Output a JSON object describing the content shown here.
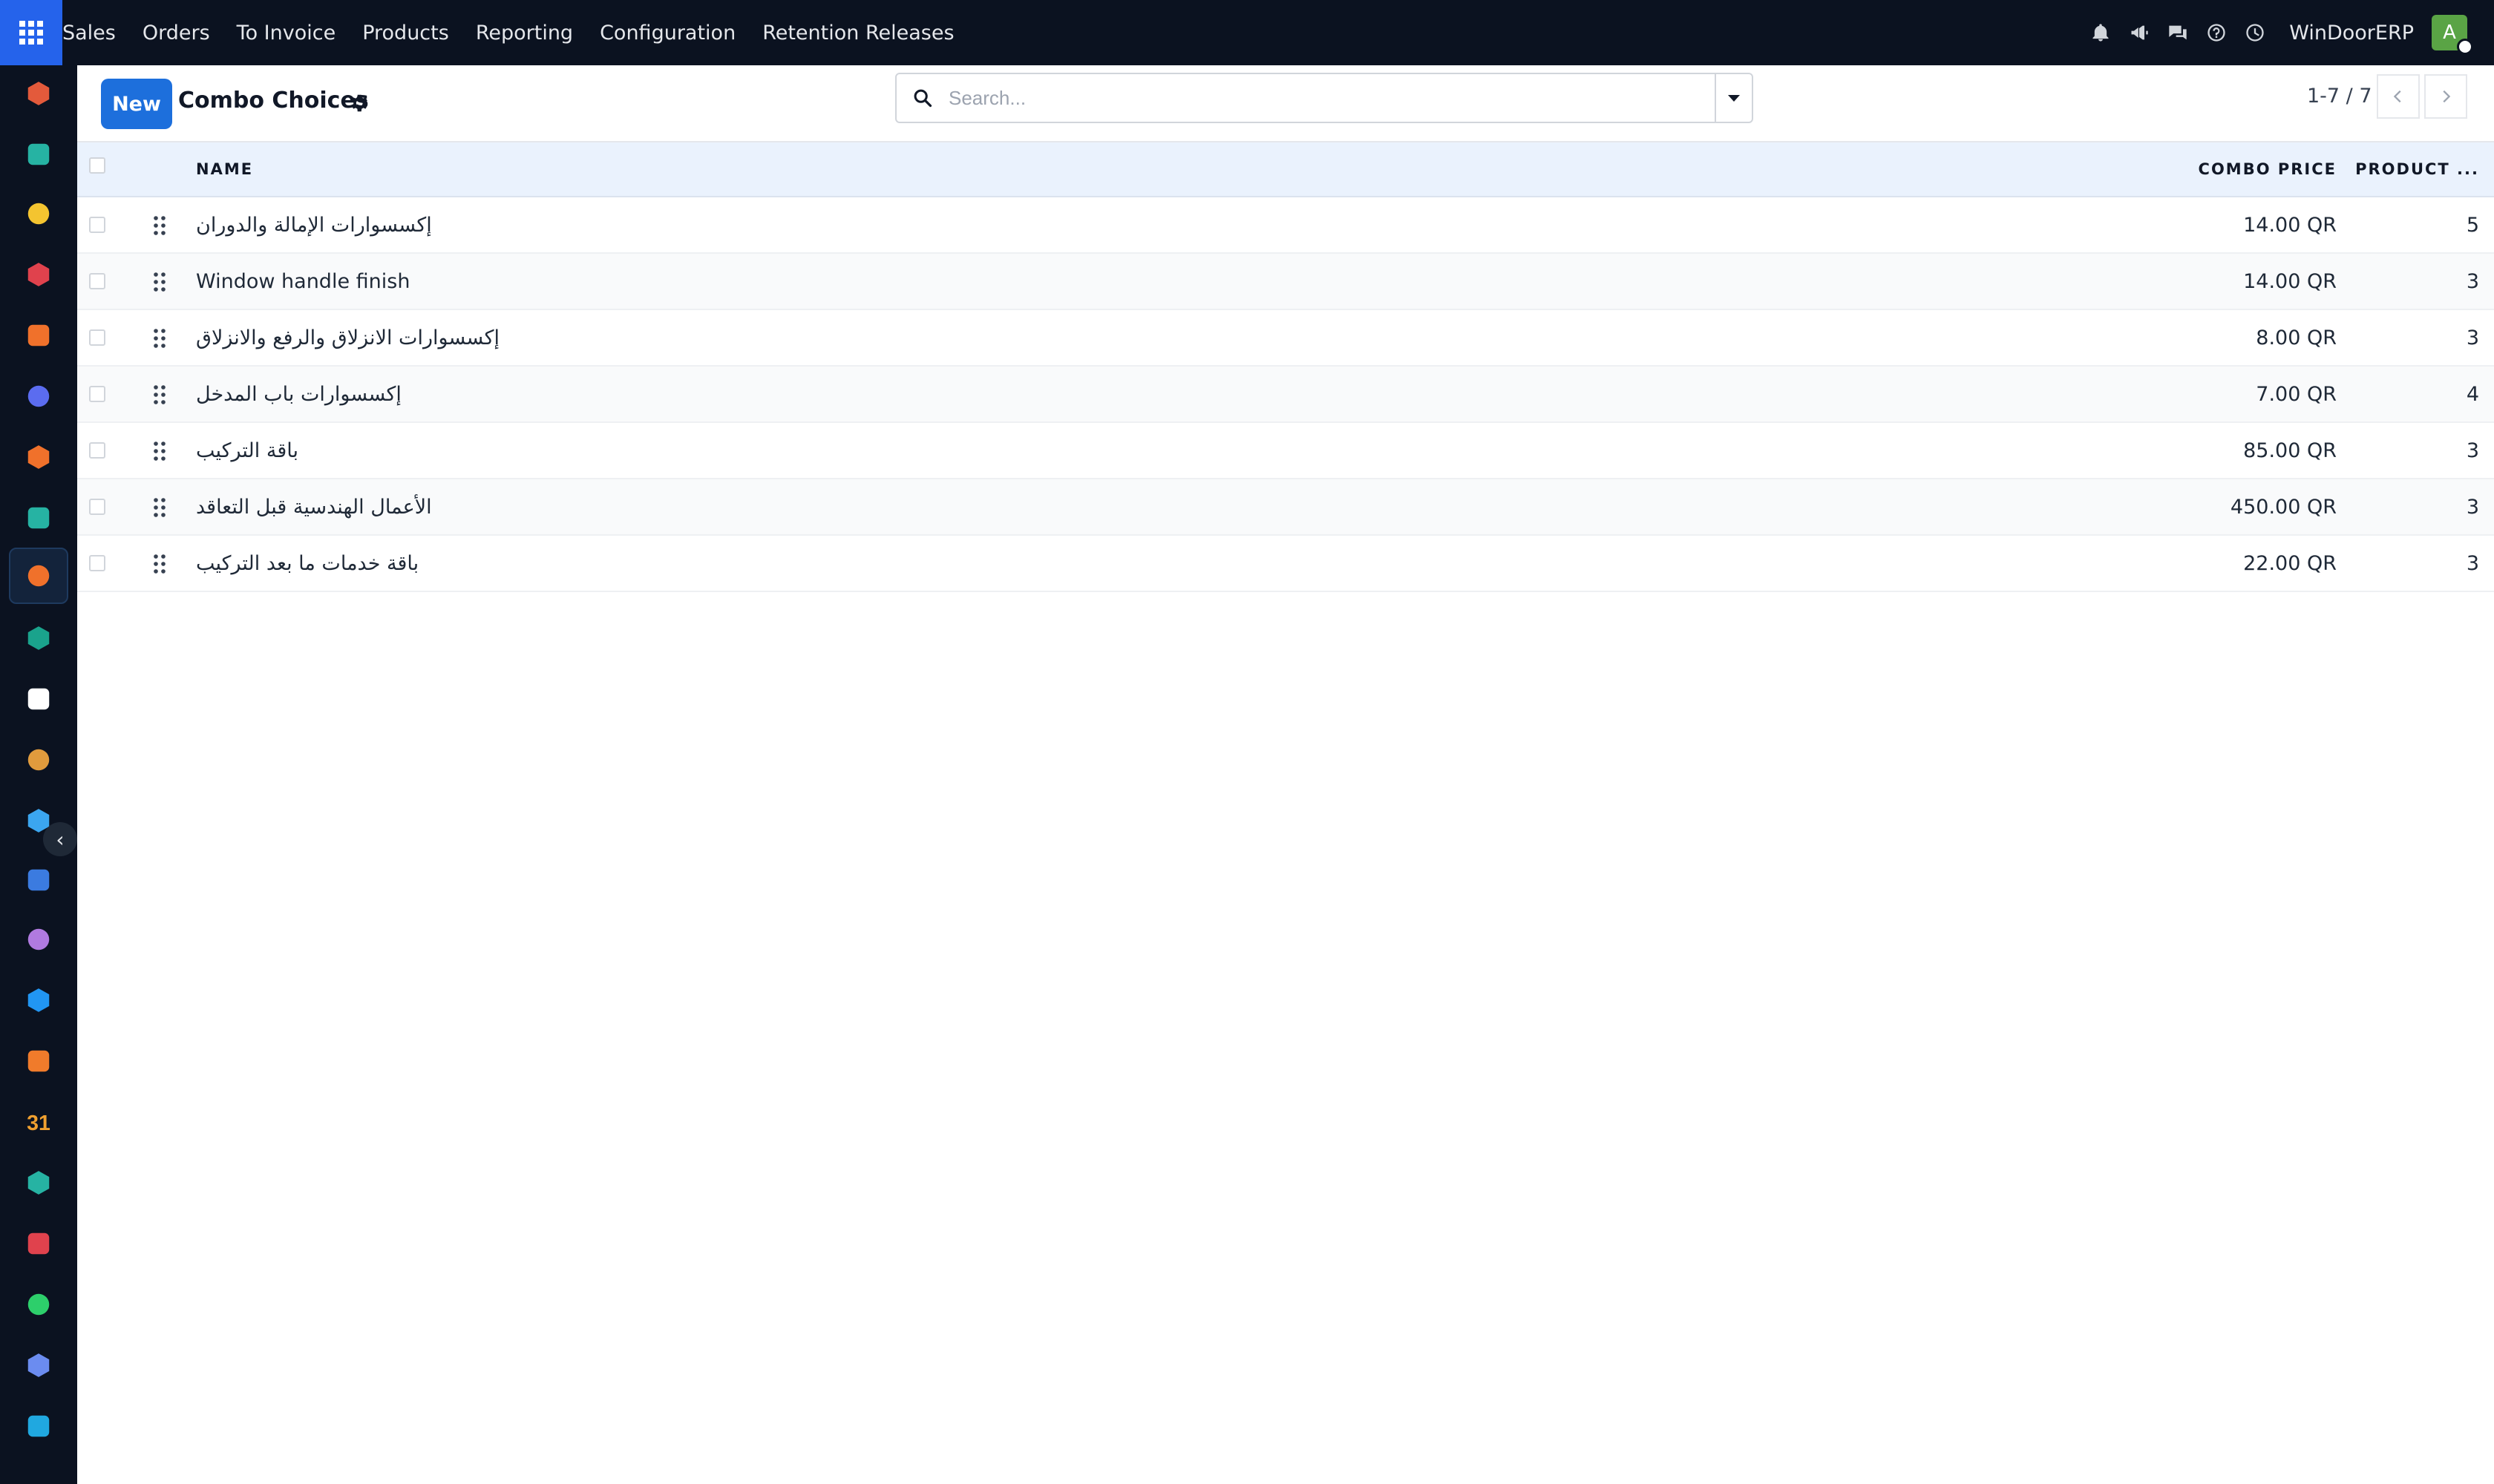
{
  "navbar": {
    "menu": [
      "Sales",
      "Orders",
      "To Invoice",
      "Products",
      "Reporting",
      "Configuration",
      "Retention Releases"
    ],
    "company": "WinDoorERP",
    "avatar_letter": "A"
  },
  "sidebar": {
    "apps": [
      {
        "icon": "cube-icon",
        "color": "#e35a3b"
      },
      {
        "icon": "chevron-check-icon",
        "color": "#26b3a3"
      },
      {
        "icon": "paper-plane-icon",
        "color": "#f4c430"
      },
      {
        "icon": "pie-chart-icon",
        "color": "#e0424d"
      },
      {
        "icon": "hexagon-icon",
        "color": "#f0712b"
      },
      {
        "icon": "mail-m-icon",
        "color": "#5b6cf0"
      },
      {
        "icon": "chat-bubble-icon",
        "color": "#f0712b"
      },
      {
        "icon": "chevron-check-icon",
        "color": "#26b3a3"
      },
      {
        "icon": "sales-chart-icon",
        "color": "#f0712b"
      },
      {
        "icon": "contacts-icon",
        "color": "#1aa38c"
      },
      {
        "icon": "box-icon",
        "color": "#ffffff"
      },
      {
        "icon": "tools-icon",
        "color": "#e09b3d"
      },
      {
        "icon": "checkmark-icon",
        "color": "#3ba6f0"
      },
      {
        "icon": "book-icon",
        "color": "#3b7be0"
      },
      {
        "icon": "package-icon",
        "color": "#b07ae0"
      },
      {
        "icon": "invoice-dollar-icon",
        "color": "#2196f3"
      },
      {
        "icon": "team-icon",
        "color": "#f07b2b"
      },
      {
        "icon": "calendar-31-icon",
        "color": "#f0a030"
      },
      {
        "icon": "pen-icon",
        "color": "#26b3a3"
      },
      {
        "icon": "dashboard-icon",
        "color": "#e0424d"
      },
      {
        "icon": "whatsapp-icon",
        "color": "#2dcf6b"
      },
      {
        "icon": "gauge-icon",
        "color": "#6b8cf0"
      },
      {
        "icon": "wave-icon",
        "color": "#20a8e0"
      }
    ]
  },
  "control": {
    "new_label": "New",
    "title": "Combo Choices",
    "search_placeholder": "Search...",
    "pager": "1-7 / 7"
  },
  "table": {
    "headers": {
      "name": "NAME",
      "price": "COMBO PRICE",
      "count": "PRODUCT ..."
    },
    "rows": [
      {
        "name": "إكسسوارات الإمالة والدوران",
        "price": "14.00 QR",
        "count": "5"
      },
      {
        "name": "Window handle finish",
        "price": "14.00 QR",
        "count": "3"
      },
      {
        "name": "إكسسوارات الانزلاق والرفع والانزلاق",
        "price": "8.00 QR",
        "count": "3"
      },
      {
        "name": "إكسسوارات باب المدخل",
        "price": "7.00 QR",
        "count": "4"
      },
      {
        "name": "باقة التركيب",
        "price": "85.00 QR",
        "count": "3"
      },
      {
        "name": "الأعمال الهندسية قبل التعاقد",
        "price": "450.00 QR",
        "count": "3"
      },
      {
        "name": "باقة خدمات ما بعد التركيب",
        "price": "22.00 QR",
        "count": "3"
      }
    ]
  }
}
